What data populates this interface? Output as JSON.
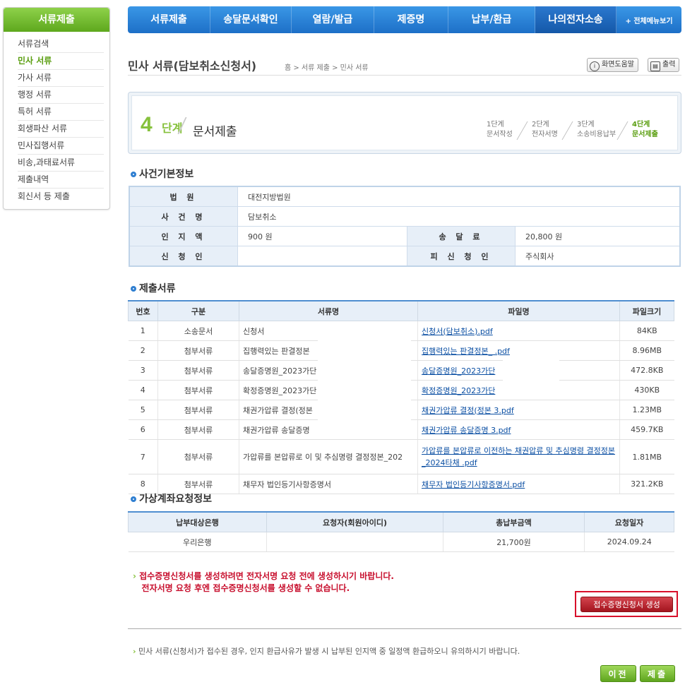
{
  "sidebar": {
    "title": "서류제출",
    "items": [
      {
        "label": "서류검색",
        "active": false
      },
      {
        "label": "민사 서류",
        "active": true
      },
      {
        "label": "가사 서류",
        "active": false
      },
      {
        "label": "행정 서류",
        "active": false
      },
      {
        "label": "특허 서류",
        "active": false
      },
      {
        "label": "회생파산 서류",
        "active": false
      },
      {
        "label": "민사집행서류",
        "active": false
      },
      {
        "label": "비송,과태료서류",
        "active": false
      },
      {
        "label": "제출내역",
        "active": false
      },
      {
        "label": "회신서 등 제출",
        "active": false
      }
    ]
  },
  "topnav": {
    "items": [
      "서류제출",
      "송달문서확인",
      "열람/발급",
      "제증명",
      "납부/환급",
      "나의전자소송"
    ],
    "active_index": 5,
    "all_menu": "+ 전체메뉴보기"
  },
  "header": {
    "title": "민사 서류(담보취소신청서)",
    "breadcrumb": "홈 > 서류 제출 > 민사 서류",
    "help_label": "화면도움말",
    "print_label": "출력"
  },
  "stepper": {
    "current_num": "4",
    "current_unit": "단계",
    "current_name": "문서제출",
    "steps": [
      {
        "num": "1단계",
        "name": "문서작성"
      },
      {
        "num": "2단계",
        "name": "전자서명"
      },
      {
        "num": "3단계",
        "name": "소송비용납부"
      },
      {
        "num": "4단계",
        "name": "문서제출"
      }
    ]
  },
  "case_info": {
    "section_title": "사건기본정보",
    "court_label": "법 원",
    "court": "대전지방법원",
    "case_name_label": "사 건 명",
    "case_name": "담보취소",
    "stamp_label": "인 지 액",
    "stamp": "900 원",
    "service_label": "송 달 료",
    "service": "20,800 원",
    "applicant_label": "신 청 인",
    "applicant": "",
    "respondent_label": "피 신 청 인",
    "respondent": "주식회사"
  },
  "documents": {
    "section_title": "제출서류",
    "columns": [
      "번호",
      "구분",
      "서류명",
      "파일명",
      "파일크기"
    ],
    "rows": [
      {
        "no": "1",
        "type": "소송문서",
        "name": "신청서",
        "file": "신청서(담보취소).pdf",
        "size": "84KB"
      },
      {
        "no": "2",
        "type": "첨부서류",
        "name": "집행력있는 판결정본",
        "file": "집행력있는 판결정본_                        .pdf",
        "size": "8.96MB"
      },
      {
        "no": "3",
        "type": "첨부서류",
        "name": "송달증명원_2023가단",
        "file": "송달증명원_2023가단",
        "size": "472.8KB"
      },
      {
        "no": "4",
        "type": "첨부서류",
        "name": "확정증명원_2023가단",
        "file": "확정증명원_2023가단",
        "size": "430KB"
      },
      {
        "no": "5",
        "type": "첨부서류",
        "name": "채권가압류 결정(정본",
        "file": "채권가압류 결정(정본                    3.pdf",
        "size": "1.23MB"
      },
      {
        "no": "6",
        "type": "첨부서류",
        "name": "채권가압류 송달증명",
        "file": "채권가압류 송달증명                     3.pdf",
        "size": "459.7KB"
      },
      {
        "no": "7",
        "type": "첨부서류",
        "name": "가압류를 본압류로 이                    및 추심명령 결정정본_202",
        "file": "가압류를 본압류로 이전하는 채권압류 및 추심명령 결정정본_2024타채        .pdf",
        "size": "1.81MB"
      },
      {
        "no": "8",
        "type": "첨부서류",
        "name": "채무자 법인등기사항증명서",
        "file": "채무자 법인등기사항증명서.pdf",
        "size": "321.2KB"
      }
    ]
  },
  "virtual_account": {
    "section_title": "가상계좌요청정보",
    "columns": [
      "납부대상은행",
      "요청자(회원아이디)",
      "총납부금액",
      "요청일자"
    ],
    "row": {
      "bank": "우리은행",
      "requester": "",
      "amount": "21,700원",
      "date": "2024.09.24"
    }
  },
  "notice": {
    "line1": "접수증명신청서를 생성하려면 전자서명 요청 전에 생성하시기 바랍니다.",
    "line2": "전자서명 요청 후엔 접수증명신청서를 생성할 수 없습니다.",
    "generate_label": "접수증명신청서 생성"
  },
  "footnote": "민사 서류(신청서)가 접수된 경우, 인지 환급사유가 발생 시 납부된 인지액 중 일정액 환급하오니 유의하시기 바랍니다.",
  "buttons": {
    "prev": "이전",
    "submit": "제출"
  }
}
